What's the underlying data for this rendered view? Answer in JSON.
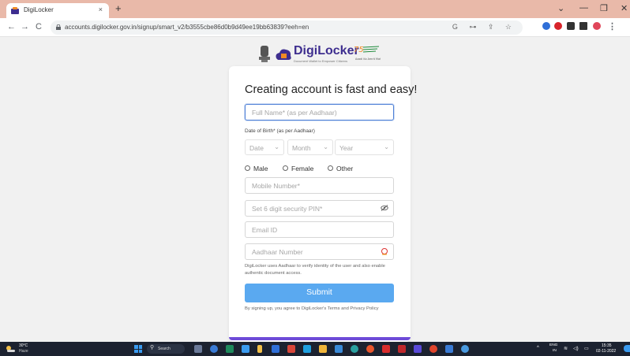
{
  "browser": {
    "tab_title": "DigiLocker",
    "tab_close": "×",
    "new_tab": "+",
    "url": "accounts.digilocker.gov.in/signup/smart_v2/b3555cbe86d0b9d49ee19bb63839?eeh=en",
    "window_controls": {
      "minimize": "—",
      "restore": "❐",
      "close": "✕",
      "chevron": "⌄"
    },
    "nav": {
      "back": "←",
      "forward": "→",
      "reload": "C"
    },
    "omnibox_icons": "G ⊶ ⇪ ☆",
    "colors": {
      "titlebar": "#e9b9a9",
      "toolbar": "#ffffff"
    }
  },
  "brand": {
    "name": "DigiLocker",
    "tagline": "Document Wallet to Empower Citizens",
    "azadi_text": "Azadi Ka Amrit Mahotsav",
    "primary_color": "#3e2e8f"
  },
  "form": {
    "heading": "Creating account is fast and easy!",
    "full_name_placeholder": "Full Name* (as per Aadhaar)",
    "dob_label": "Date of Birth* (as per Aadhaar)",
    "dob": {
      "date": "Date",
      "month": "Month",
      "year": "Year"
    },
    "gender_options": [
      "Male",
      "Female",
      "Other"
    ],
    "mobile_placeholder": "Mobile Number*",
    "pin_placeholder": "Set 6 digit security PIN*",
    "pin_toggle_icon": "eye-slash-icon",
    "email_placeholder": "Email ID",
    "aadhaar_placeholder": "Aadhaar Number",
    "aadhaar_note": "DigiLocker uses Aadhaar to verify identity of the user and also enable authentic document access.",
    "submit_label": "Submit",
    "terms": "By signing up, you agree to DigiLocker's Terms and Privacy Policy",
    "colors": {
      "submit": "#5aa9f0",
      "focus_border": "#4d7fd6",
      "card_accent": "#6e4bd8"
    }
  },
  "taskbar": {
    "weather_temp": "30°C",
    "weather_desc": "Haze",
    "search_label": "Search",
    "lang_line1": "ENG",
    "lang_line2": "IN",
    "time": "15:35",
    "date": "02-11-2022",
    "tray_icons": "^  ≋ ◁) ▭"
  }
}
